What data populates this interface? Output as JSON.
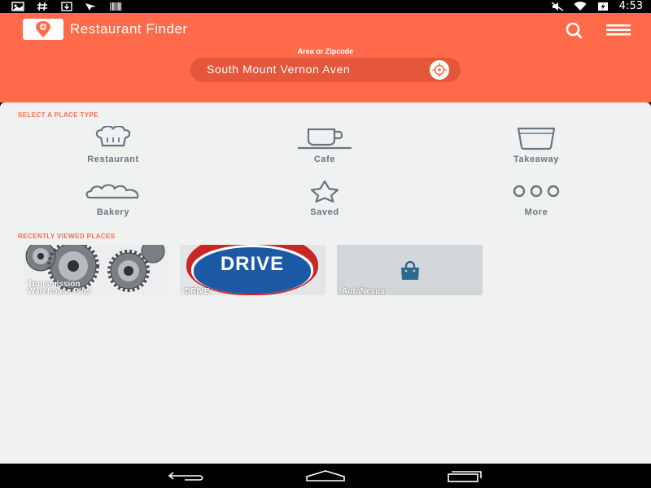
{
  "status_bar": {
    "left_icons": [
      "photo-icon",
      "hash-icon",
      "download-icon",
      "pointer-icon",
      "barcode-icon"
    ],
    "right_icons": [
      "mute-icon",
      "wifi-icon",
      "battery-icon"
    ],
    "time": "4:53"
  },
  "header": {
    "title": "Restaurant Finder",
    "area_label": "Area or Zipcode",
    "location": "South Mount Vernon Aven",
    "icons": [
      "search-icon",
      "menu-icon",
      "location-target-icon"
    ]
  },
  "place_types": {
    "title": "SELECT A PLACE TYPE",
    "items": [
      {
        "label": "Restaurant",
        "icon": "chef-hat-icon"
      },
      {
        "label": "Cafe",
        "icon": "coffee-cup-icon"
      },
      {
        "label": "Takeaway",
        "icon": "takeaway-box-icon"
      },
      {
        "label": "Bakery",
        "icon": "cloud-bread-icon"
      },
      {
        "label": "Saved",
        "icon": "star-icon"
      },
      {
        "label": "More",
        "icon": "more-icon"
      }
    ]
  },
  "recent": {
    "title": "RECENTLY VIEWED PLACES",
    "items": [
      {
        "name": "Transmission Warehouse Plus",
        "line1": "Transmission",
        "line2": "Warehouse Plus",
        "image": "gears-image"
      },
      {
        "name": "DRIVE",
        "line1": "DRIVE",
        "sign_text": "DRIVE",
        "image": "drive-sign-image"
      },
      {
        "name": "AutoNexus",
        "line1": "AutoNexus",
        "image": "shopping-bag-icon"
      }
    ]
  },
  "colors": {
    "accent": "#ff6b4a",
    "pill": "#e4573a",
    "icon_gray": "#6b7580",
    "background": "#f0f1f1"
  }
}
